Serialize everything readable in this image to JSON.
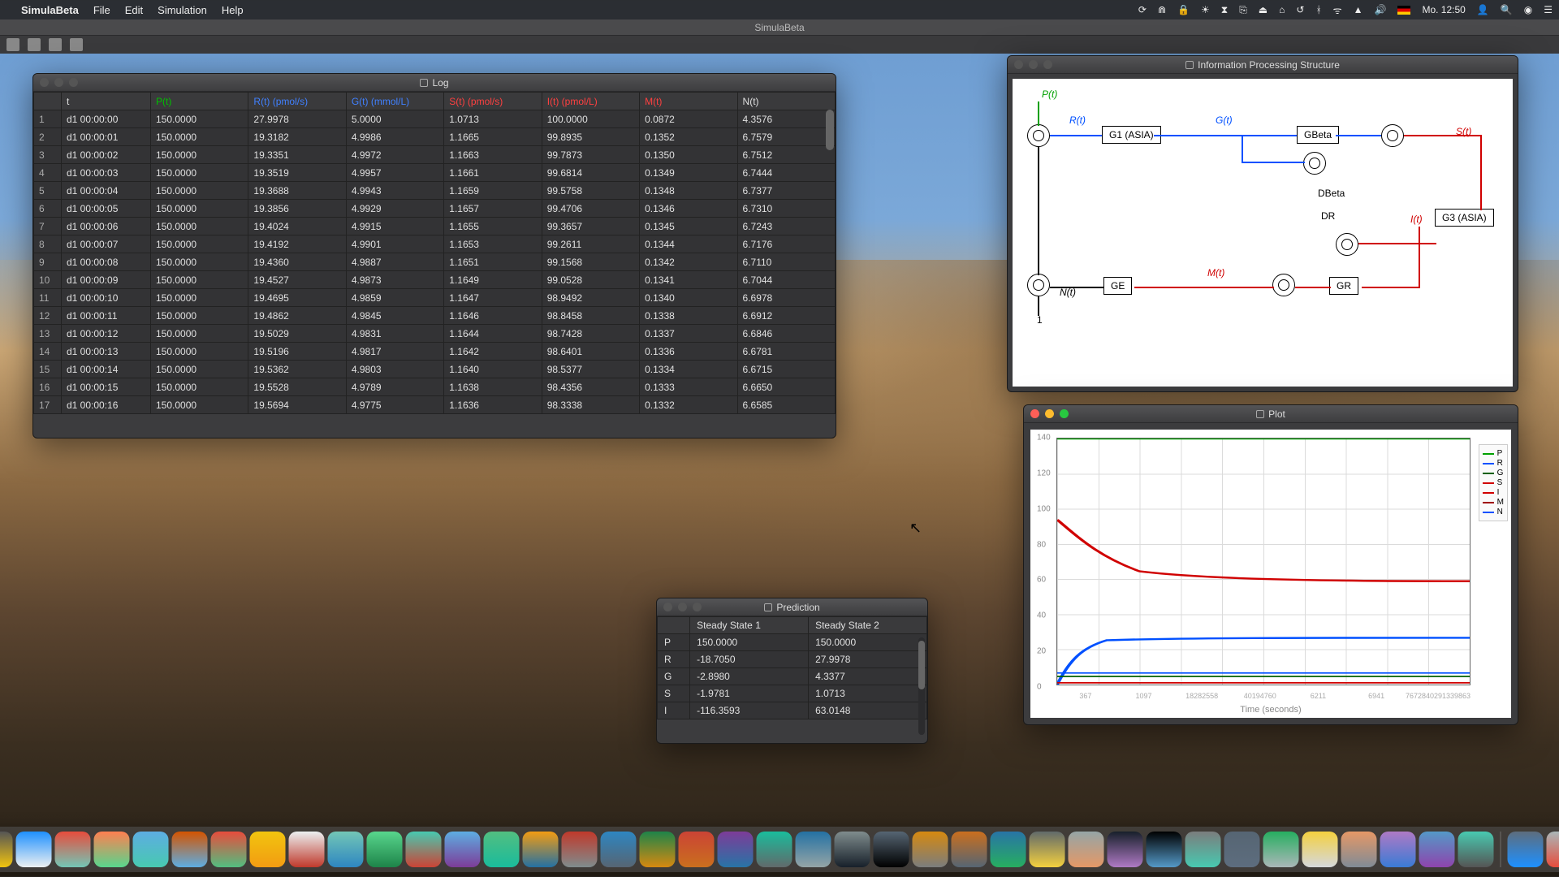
{
  "menubar": {
    "app_name": "SimulaBeta",
    "items": [
      "File",
      "Edit",
      "Simulation",
      "Help"
    ],
    "clock": "Mo. 12:50",
    "status_icons": [
      "sync-icon",
      "magnet-icon",
      "lock-icon",
      "brightness-icon",
      "timer-icon",
      "clipboard-icon",
      "eject-icon",
      "home-icon",
      "time-machine-icon",
      "bluetooth-icon",
      "wifi-icon",
      "airplay-icon",
      "volume-icon",
      "flag-icon",
      "user-icon",
      "search-icon",
      "siri-icon",
      "menu-icon"
    ]
  },
  "app_window_title": "SimulaBeta",
  "log": {
    "title": "Log",
    "headers": [
      "",
      "t",
      "P(t)",
      "R(t) (pmol/s)",
      "G(t) (mmol/L)",
      "S(t) (pmol/s)",
      "I(t) (pmol/L)",
      "M(t)",
      "N(t)"
    ],
    "header_colors": {
      "P(t)": "#00c000",
      "R(t) (pmol/s)": "#4080ff",
      "G(t) (mmol/L)": "#4080ff",
      "S(t) (pmol/s)": "#ff4040",
      "I(t) (pmol/L)": "#ff4040",
      "M(t)": "#ff4040"
    },
    "rows": [
      [
        "1",
        "d1 00:00:00",
        "150.0000",
        "27.9978",
        "5.0000",
        "1.0713",
        "100.0000",
        "0.0872",
        "4.3576"
      ],
      [
        "2",
        "d1 00:00:01",
        "150.0000",
        "19.3182",
        "4.9986",
        "1.1665",
        "99.8935",
        "0.1352",
        "6.7579"
      ],
      [
        "3",
        "d1 00:00:02",
        "150.0000",
        "19.3351",
        "4.9972",
        "1.1663",
        "99.7873",
        "0.1350",
        "6.7512"
      ],
      [
        "4",
        "d1 00:00:03",
        "150.0000",
        "19.3519",
        "4.9957",
        "1.1661",
        "99.6814",
        "0.1349",
        "6.7444"
      ],
      [
        "5",
        "d1 00:00:04",
        "150.0000",
        "19.3688",
        "4.9943",
        "1.1659",
        "99.5758",
        "0.1348",
        "6.7377"
      ],
      [
        "6",
        "d1 00:00:05",
        "150.0000",
        "19.3856",
        "4.9929",
        "1.1657",
        "99.4706",
        "0.1346",
        "6.7310"
      ],
      [
        "7",
        "d1 00:00:06",
        "150.0000",
        "19.4024",
        "4.9915",
        "1.1655",
        "99.3657",
        "0.1345",
        "6.7243"
      ],
      [
        "8",
        "d1 00:00:07",
        "150.0000",
        "19.4192",
        "4.9901",
        "1.1653",
        "99.2611",
        "0.1344",
        "6.7176"
      ],
      [
        "9",
        "d1 00:00:08",
        "150.0000",
        "19.4360",
        "4.9887",
        "1.1651",
        "99.1568",
        "0.1342",
        "6.7110"
      ],
      [
        "10",
        "d1 00:00:09",
        "150.0000",
        "19.4527",
        "4.9873",
        "1.1649",
        "99.0528",
        "0.1341",
        "6.7044"
      ],
      [
        "11",
        "d1 00:00:10",
        "150.0000",
        "19.4695",
        "4.9859",
        "1.1647",
        "98.9492",
        "0.1340",
        "6.6978"
      ],
      [
        "12",
        "d1 00:00:11",
        "150.0000",
        "19.4862",
        "4.9845",
        "1.1646",
        "98.8458",
        "0.1338",
        "6.6912"
      ],
      [
        "13",
        "d1 00:00:12",
        "150.0000",
        "19.5029",
        "4.9831",
        "1.1644",
        "98.7428",
        "0.1337",
        "6.6846"
      ],
      [
        "14",
        "d1 00:00:13",
        "150.0000",
        "19.5196",
        "4.9817",
        "1.1642",
        "98.6401",
        "0.1336",
        "6.6781"
      ],
      [
        "15",
        "d1 00:00:14",
        "150.0000",
        "19.5362",
        "4.9803",
        "1.1640",
        "98.5377",
        "0.1334",
        "6.6715"
      ],
      [
        "16",
        "d1 00:00:15",
        "150.0000",
        "19.5528",
        "4.9789",
        "1.1638",
        "98.4356",
        "0.1333",
        "6.6650"
      ],
      [
        "17",
        "d1 00:00:16",
        "150.0000",
        "19.5694",
        "4.9775",
        "1.1636",
        "98.3338",
        "0.1332",
        "6.6585"
      ]
    ]
  },
  "ips": {
    "title": "Information Processing Structure",
    "labels": {
      "P": "P(t)",
      "R": "R(t)",
      "G": "G(t)",
      "S": "S(t)",
      "I": "I(t)",
      "M": "M(t)",
      "N": "N(t)",
      "DR": "DR",
      "DBeta": "DBeta",
      "one": "1"
    },
    "boxes": {
      "G1": "G1 (ASIA)",
      "GBeta": "GBeta",
      "G3": "G3 (ASIA)",
      "GE": "GE",
      "GR": "GR"
    }
  },
  "plot": {
    "title": "Plot",
    "xlabel": "Time (seconds)",
    "xticks": [
      "367",
      "1097",
      "18282558",
      "40194760",
      "6211",
      "6941",
      "7672840291339863"
    ],
    "yticks": [
      "0",
      "20",
      "40",
      "60",
      "80",
      "100",
      "120",
      "140"
    ],
    "legend": [
      "P",
      "R",
      "G",
      "S",
      "I",
      "M",
      "N"
    ]
  },
  "prediction": {
    "title": "Prediction",
    "headers": [
      "",
      "Steady State 1",
      "Steady State 2"
    ],
    "rows": [
      [
        "P",
        "150.0000",
        "150.0000"
      ],
      [
        "R",
        "-18.7050",
        "27.9978"
      ],
      [
        "G",
        "-2.8980",
        "4.3377"
      ],
      [
        "S",
        "-1.9781",
        "1.0713"
      ],
      [
        "I",
        "-116.3593",
        "63.0148"
      ]
    ]
  },
  "chart_data": {
    "type": "line",
    "title": "Plot",
    "xlabel": "Time (seconds)",
    "ylim": [
      0,
      150
    ],
    "series": [
      {
        "name": "P",
        "color": "#00a000",
        "approx": "constant at 150"
      },
      {
        "name": "R",
        "color": "#0050ff",
        "approx": "rises from ~0 to ~28 quickly then flat"
      },
      {
        "name": "G",
        "color": "#0050ff",
        "approx": "near 5, flat"
      },
      {
        "name": "S",
        "color": "#d00000",
        "approx": "near 1, flat"
      },
      {
        "name": "I",
        "color": "#d00000",
        "approx": "starts 100, decays to ~63"
      },
      {
        "name": "M",
        "color": "#d00000",
        "approx": "near 0"
      },
      {
        "name": "N",
        "color": "#000",
        "approx": "near 7, flat"
      }
    ]
  },
  "dock_icons": [
    "finder",
    "launchpad",
    "mission",
    "safari",
    "opera",
    "firefox",
    "preview",
    "contacts",
    "calendar",
    "notes",
    "reminders",
    "maps",
    "photos",
    "messages",
    "facetime",
    "ichat",
    "pages",
    "acrobat",
    "word",
    "excel",
    "powerpoint",
    "onenote",
    "numbers",
    "keynote",
    "sysprefs",
    "automator",
    "itunes",
    "books",
    "appstore",
    "settings",
    "keychain",
    "activity",
    "terminal",
    "scanner",
    "printer",
    "android",
    "xcode",
    "app1",
    "app2",
    "app3",
    "app4",
    "files",
    "textedit",
    "docs",
    "trash"
  ]
}
